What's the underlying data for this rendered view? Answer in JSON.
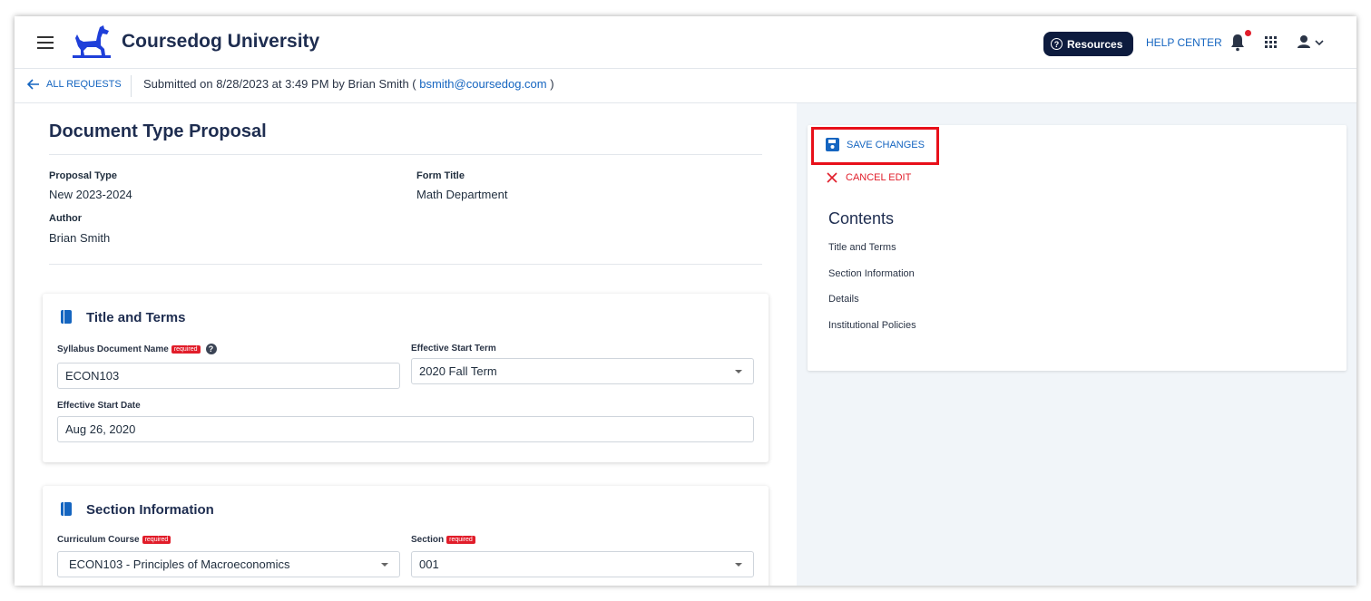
{
  "header": {
    "brand": "Coursedog University",
    "resources_label": "Resources",
    "help_center_label": "HELP CENTER"
  },
  "subbar": {
    "back_label": "ALL REQUESTS",
    "submitted_prefix": "Submitted on 8/28/2023 at 3:49 PM by Brian Smith (",
    "submitted_email": "bsmith@coursedog.com",
    "submitted_suffix": ")"
  },
  "proposal": {
    "title": "Document Type Proposal",
    "proposal_type_label": "Proposal Type",
    "proposal_type_value": "New 2023-2024",
    "form_title_label": "Form Title",
    "form_title_value": "Math Department",
    "author_label": "Author",
    "author_value": "Brian Smith"
  },
  "title_terms": {
    "heading": "Title and Terms",
    "syllabus_label": "Syllabus Document Name",
    "required_badge": "required",
    "syllabus_value": "ECON103",
    "effective_term_label": "Effective Start Term",
    "effective_term_value": "2020 Fall Term",
    "effective_date_label": "Effective Start Date",
    "effective_date_value": "Aug 26, 2020"
  },
  "section_info": {
    "heading": "Section Information",
    "course_label": "Curriculum Course",
    "course_value": "ECON103 - Principles of Macroeconomics",
    "section_label": "Section",
    "section_value": "001",
    "required_badge": "required"
  },
  "sidebar": {
    "save_label": "SAVE CHANGES",
    "cancel_label": "CANCEL EDIT",
    "contents_title": "Contents",
    "contents_items": [
      "Title and Terms",
      "Section Information",
      "Details",
      "Institutional Policies"
    ]
  },
  "colors": {
    "accent": "#1565c0",
    "brand_navy": "#1e2d50",
    "danger": "#e11d2a",
    "highlight": "#e8101a"
  }
}
